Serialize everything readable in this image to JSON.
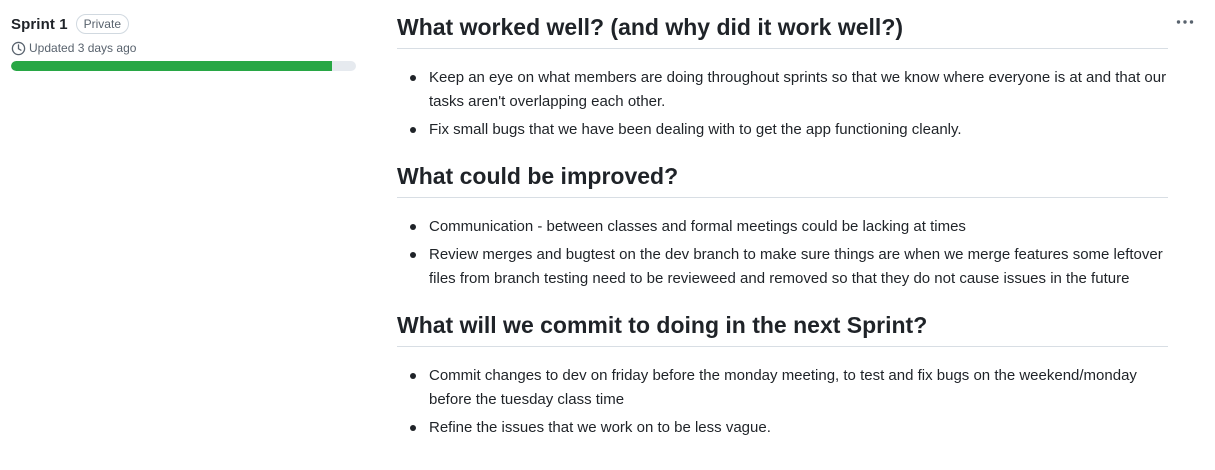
{
  "project": {
    "title": "Sprint 1",
    "visibility": "Private",
    "updated": "Updated 3 days ago",
    "progress_fraction": 0.93,
    "progress_color": "#28a745"
  },
  "menu": {
    "icon": "kebab-horizontal-icon"
  },
  "sections": [
    {
      "heading": "What worked well? (and why did it work well?)",
      "items": [
        "Keep an eye on what members are doing throughout sprints so that we know where everyone is at and that our tasks aren't overlapping each other.",
        "Fix small bugs that we have been dealing with to get the app functioning cleanly."
      ]
    },
    {
      "heading": "What could be improved?",
      "items": [
        "Communication - between classes and formal meetings could be lacking at times",
        "Review merges and bugtest on the dev branch to make sure things are when we merge features some leftover files from branch testing need to be revieweed and removed so that they do not cause issues in the future"
      ]
    },
    {
      "heading": "What will we commit to doing in the next Sprint?",
      "items": [
        "Commit changes to dev on friday before the monday meeting, to test and fix bugs on the weekend/monday before the tuesday class time",
        "Refine the issues that we work on to be less vague."
      ]
    }
  ]
}
